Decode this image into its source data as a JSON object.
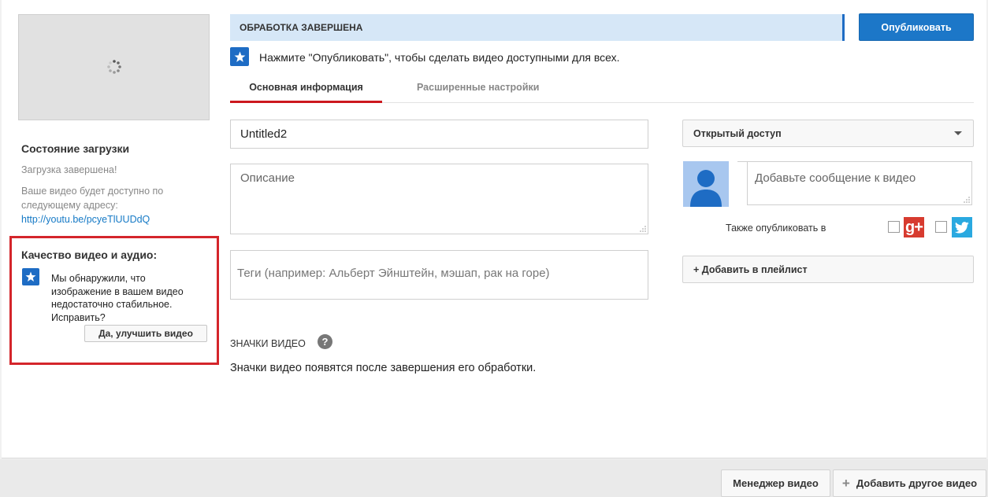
{
  "colors": {
    "accent_blue": "#1c77c8",
    "processing_bar": "#d6e7f7",
    "highlight_red": "#d4252b",
    "tab_underline": "#cc181e",
    "link": "#167ac6"
  },
  "upload_status": {
    "title": "Состояние загрузки",
    "done_text": "Загрузка завершена!",
    "url_text": "Ваше видео будет доступно по следующему адресу:",
    "url_link": "http://youtu.be/pcyeTlUUDdQ"
  },
  "quality": {
    "title": "Качество видео и аудио:",
    "message": "Мы обнаружили, что изображение в вашем видео недостаточно стабильное. Исправить?",
    "improve_button": "Да, улучшить видео"
  },
  "processing": {
    "status": "ОБРАБОТКА ЗАВЕРШЕНА",
    "publish_button": "Опубликовать",
    "notice": "Нажмите \"Опубликовать\", чтобы сделать видео доступными для всех."
  },
  "tabs": [
    {
      "label": "Основная информация",
      "active": true
    },
    {
      "label": "Расширенные настройки",
      "active": false
    }
  ],
  "form": {
    "title_value": "Untitled2",
    "description_placeholder": "Описание",
    "tags_placeholder": "Теги (например: Альберт Эйнштейн, мэшап, рак на горе)"
  },
  "thumbnails": {
    "title": "ЗНАЧКИ ВИДЕО",
    "help_icon": "?",
    "note": "Значки видео появятся после завершения его обработки."
  },
  "sidebar_right": {
    "privacy_value": "Открытый доступ",
    "message_placeholder": "Добавьте сообщение к видео",
    "also_publish_label": "Также опубликовать в",
    "gplus_label": "g+",
    "add_playlist": "+ Добавить в плейлист"
  },
  "footer": {
    "manager_button": "Менеджер видео",
    "add_button": "Добавить другое видео"
  }
}
